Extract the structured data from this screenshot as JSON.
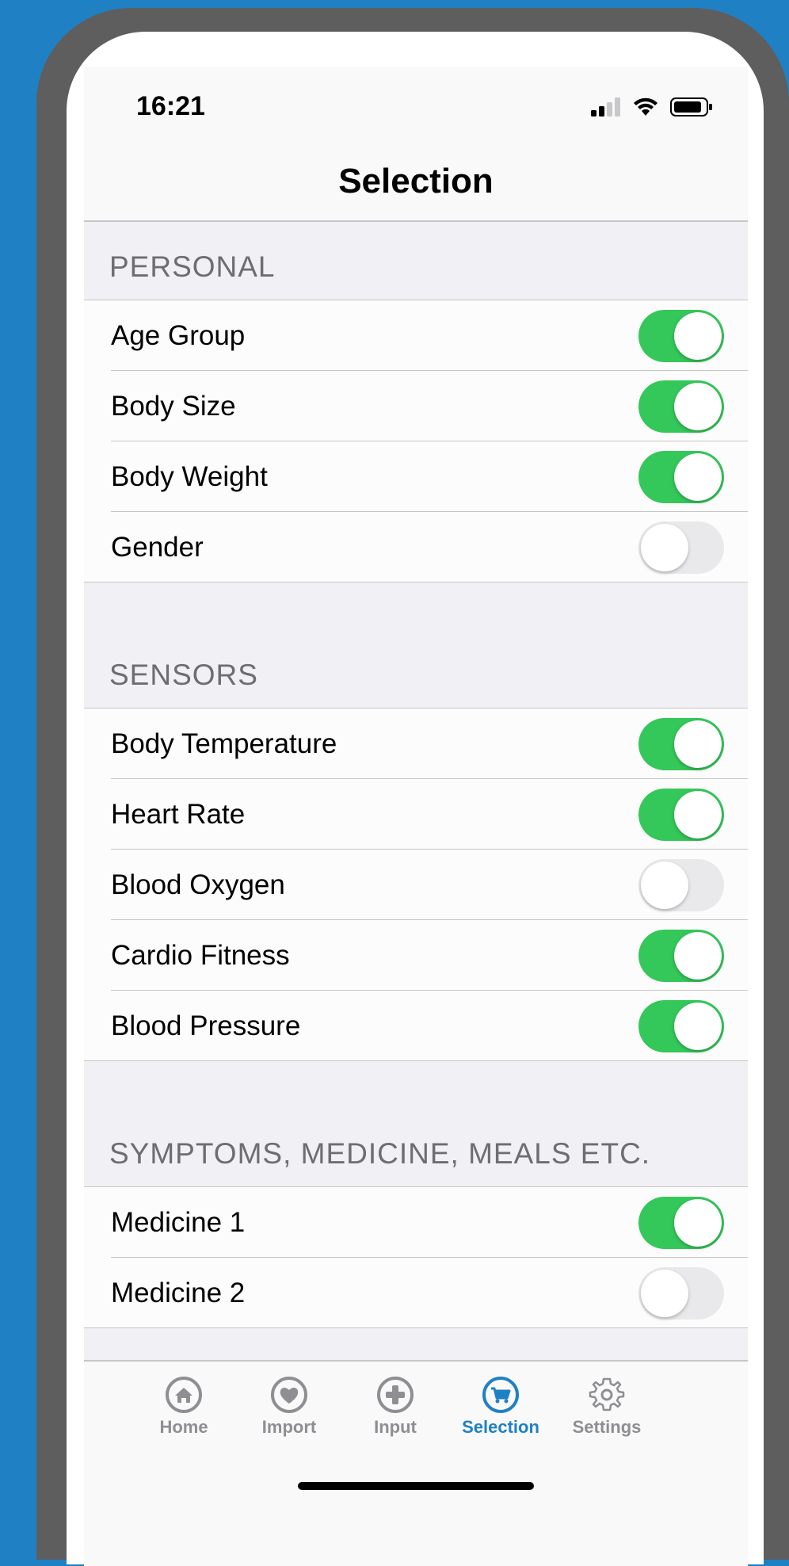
{
  "status_bar": {
    "time": "16:21"
  },
  "nav": {
    "title": "Selection"
  },
  "sections": [
    {
      "header": "PERSONAL",
      "items": [
        {
          "label": "Age Group",
          "on": true
        },
        {
          "label": "Body Size",
          "on": true
        },
        {
          "label": "Body Weight",
          "on": true
        },
        {
          "label": "Gender",
          "on": false
        }
      ]
    },
    {
      "header": "SENSORS",
      "items": [
        {
          "label": "Body Temperature",
          "on": true
        },
        {
          "label": "Heart Rate",
          "on": true
        },
        {
          "label": "Blood Oxygen",
          "on": false
        },
        {
          "label": "Cardio Fitness",
          "on": true
        },
        {
          "label": "Blood Pressure",
          "on": true
        }
      ]
    },
    {
      "header": "SYMPTOMS, MEDICINE, MEALS ETC.",
      "items": [
        {
          "label": "Medicine 1",
          "on": true
        },
        {
          "label": "Medicine 2",
          "on": false
        }
      ]
    }
  ],
  "tab_bar": {
    "tabs": [
      {
        "label": "Home",
        "icon": "home-icon",
        "active": false
      },
      {
        "label": "Import",
        "icon": "heart-icon",
        "active": false
      },
      {
        "label": "Input",
        "icon": "plus-icon",
        "active": false
      },
      {
        "label": "Selection",
        "icon": "cart-icon",
        "active": true
      },
      {
        "label": "Settings",
        "icon": "gear-icon",
        "active": false
      }
    ]
  },
  "colors": {
    "background": "#1f81c4",
    "toggle_on": "#34c759",
    "toggle_off": "#e9e9eb",
    "tab_active": "#1f81c4",
    "tab_inactive": "#8e8e93"
  }
}
